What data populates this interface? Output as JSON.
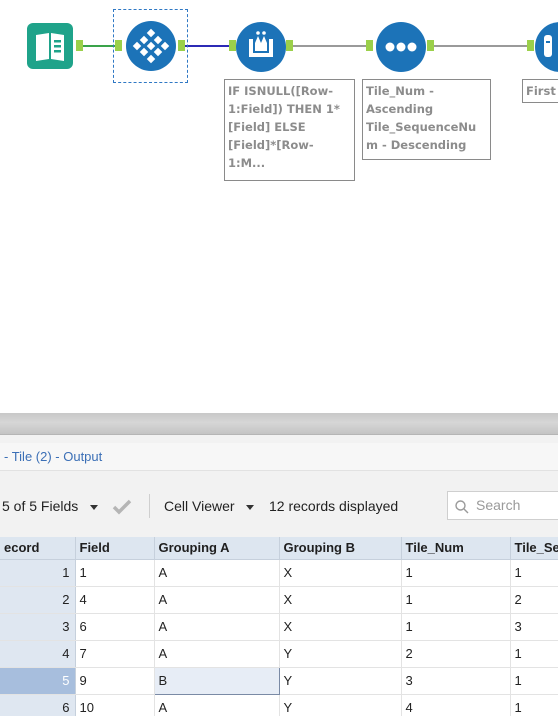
{
  "workflow": {
    "tools": [
      {
        "name": "input-data-tool",
        "icon": "book-icon",
        "color": "#1fa38a"
      },
      {
        "name": "tile-tool",
        "icon": "diamond-grid-icon",
        "color": "#1c73b8"
      },
      {
        "name": "multi-row-formula-tool",
        "icon": "flask-icon",
        "color": "#1c73b8"
      },
      {
        "name": "sort-tool",
        "icon": "dots-icon",
        "color": "#1c73b8"
      },
      {
        "name": "sample-tool",
        "icon": "tube-icon",
        "color": "#1c73b8"
      }
    ],
    "annotations": {
      "formula": [
        "IF ISNULL([Row-",
        "1:Field]) THEN 1*",
        "[Field] ELSE",
        "[Field]*[Row-",
        "1:M..."
      ],
      "sort": [
        "Tile_Num -",
        "Ascending",
        "Tile_SequenceNu",
        "m - Descending"
      ],
      "sample": [
        "First"
      ]
    }
  },
  "results": {
    "title": "- Tile (2) - Output",
    "toolbar": {
      "fields": "5 of 5 Fields",
      "viewer": "Cell Viewer",
      "records": "12 records displayed",
      "search_placeholder": "Search"
    },
    "columns": [
      "ecord",
      "Field",
      "Grouping A",
      "Grouping B",
      "Tile_Num",
      "Tile_Se"
    ],
    "rows": [
      [
        "1",
        "1",
        "A",
        "X",
        "1",
        "1"
      ],
      [
        "2",
        "4",
        "A",
        "X",
        "1",
        "2"
      ],
      [
        "3",
        "6",
        "A",
        "X",
        "1",
        "3"
      ],
      [
        "4",
        "7",
        "A",
        "Y",
        "2",
        "1"
      ],
      [
        "5",
        "9",
        "B",
        "Y",
        "3",
        "1"
      ],
      [
        "6",
        "10",
        "A",
        "Y",
        "4",
        "1"
      ]
    ],
    "selected_record": "5"
  }
}
